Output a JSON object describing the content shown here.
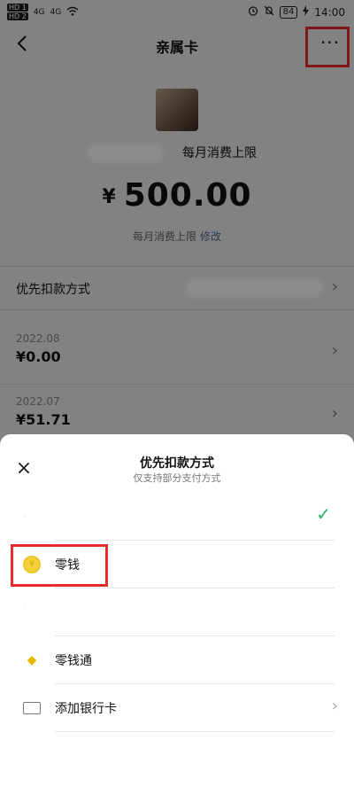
{
  "status": {
    "hd1": "HD 1",
    "hd2": "HD 2",
    "net1": "4G",
    "net2": "4G",
    "battery": "84",
    "time": "14:00"
  },
  "nav": {
    "back_icon": "chevron-left-icon",
    "title": "亲属卡",
    "more_icon": "more-dots-icon",
    "more_glyph": "···"
  },
  "summary": {
    "limit_caption_top": "每月消费上限",
    "currency": "¥",
    "amount": "500.00",
    "limit_caption": "每月消费上限",
    "edit_link": "修改"
  },
  "payment": {
    "label": "优先扣款方式"
  },
  "history": [
    {
      "date": "2022.08",
      "amount": "¥0.00"
    },
    {
      "date": "2022.07",
      "amount": "¥51.71"
    }
  ],
  "sheet": {
    "close_glyph": "×",
    "title": "优先扣款方式",
    "subtitle": "仅支持部分支付方式",
    "options": [
      {
        "label": "零钱",
        "icon": "change-coin-icon",
        "coin_glyph": "¥"
      },
      {
        "label": "零钱通",
        "icon": "lingqiantong-diamond-icon",
        "diamond_glyph": "◆"
      },
      {
        "label": "添加银行卡",
        "icon": "bank-card-icon"
      }
    ],
    "check_glyph": "✓",
    "chevron_glyph": "›"
  },
  "colors": {
    "highlight_frame": "#e52b2b",
    "check": "#2aae67",
    "link": "#576b95"
  }
}
